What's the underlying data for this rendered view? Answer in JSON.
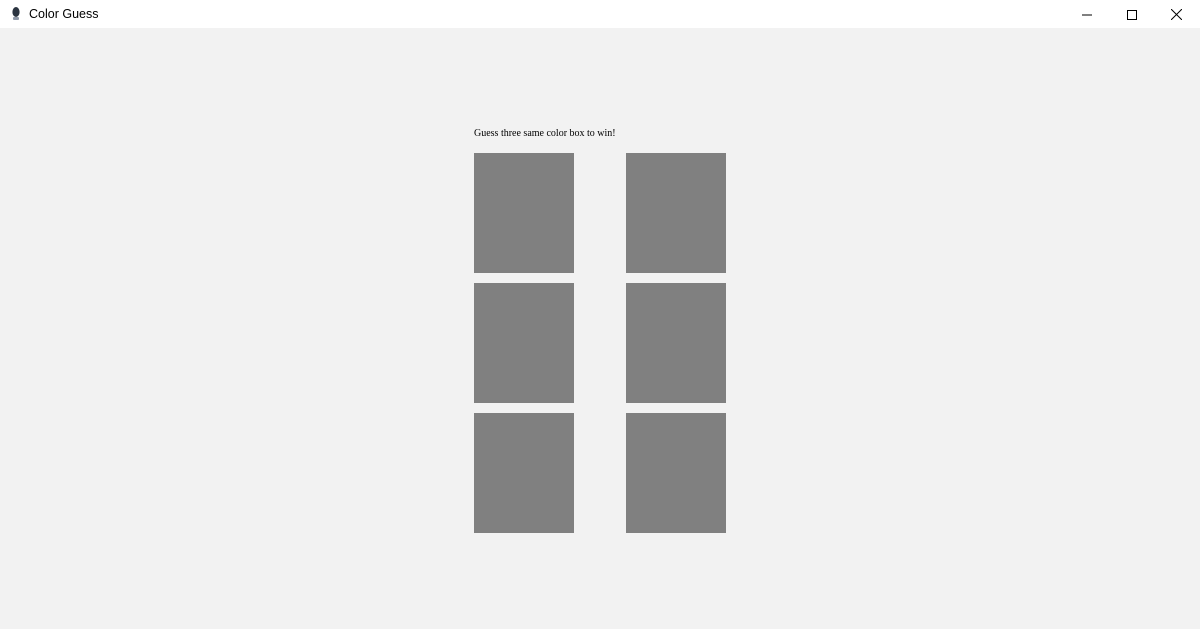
{
  "window": {
    "title": "Color Guess",
    "app_icon": "tk-feather-icon",
    "controls": [
      "minimize-icon",
      "maximize-icon",
      "close-icon"
    ]
  },
  "game": {
    "instructions": "Guess three same color box to win!",
    "boxes": [
      {
        "color": "#808080"
      },
      {
        "color": "#808080"
      },
      {
        "color": "#808080"
      },
      {
        "color": "#808080"
      },
      {
        "color": "#808080"
      },
      {
        "color": "#808080"
      }
    ]
  },
  "colors": {
    "background": "#f2f2f2",
    "titlebar": "#ffffff",
    "box_hidden": "#808080"
  }
}
